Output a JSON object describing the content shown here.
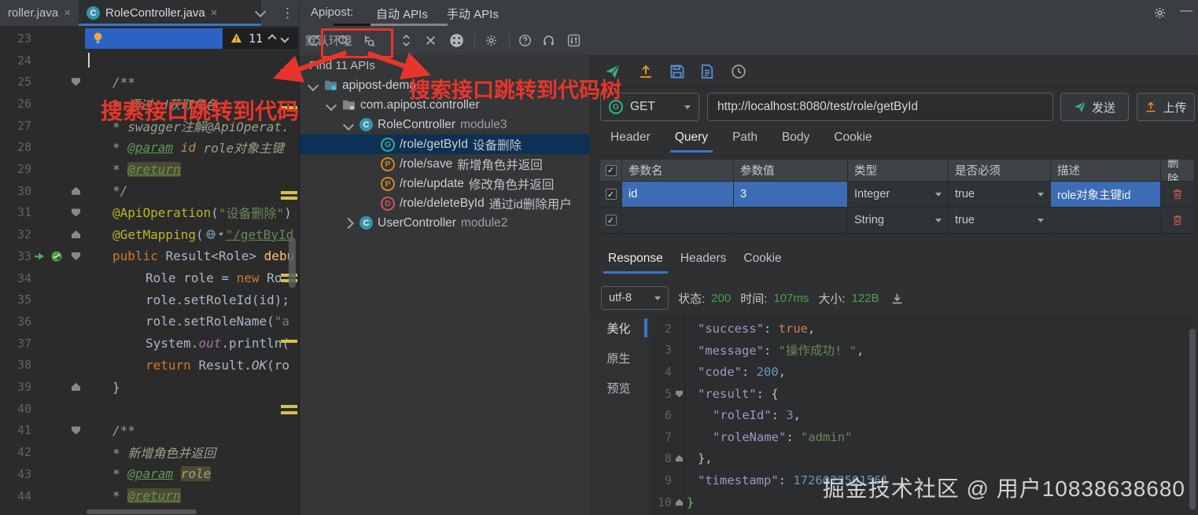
{
  "colors": {
    "accent": "#3876c8",
    "annotation_red": "#e8352b",
    "success_green": "#4d9e4d",
    "selection_blue": "#3c6cb4"
  },
  "window": {
    "tab_prev": "roller.java",
    "tab_active": "RoleController.java",
    "close_glyph": "×",
    "apipost_label": "Apipost:",
    "apipost_tabs": [
      "自动 APIs",
      "手动 APIs"
    ],
    "environment": "默认环境",
    "minimize_glyph": "—"
  },
  "editor": {
    "lightbulb": {
      "count": "11"
    },
    "lines": [
      {
        "n": 23,
        "type": "lightbulb"
      },
      {
        "n": 24,
        "type": "cursor"
      },
      {
        "n": 25,
        "indent": 1,
        "fold": "down",
        "segs": [
          {
            "t": "/**",
            "c": "doc"
          }
        ]
      },
      {
        "n": 26,
        "indent": 1,
        "segs": [
          {
            "t": "* 通过id获取角色",
            "c": "doc"
          }
        ]
      },
      {
        "n": 27,
        "indent": 1,
        "segs": [
          {
            "t": "* swagger注解@ApiOperat.",
            "c": "doc"
          }
        ]
      },
      {
        "n": 28,
        "indent": 1,
        "segs": [
          {
            "t": "* ",
            "c": "doc"
          },
          {
            "t": "@param",
            "c": "doctag"
          },
          {
            "t": " id",
            "c": "docparam"
          },
          {
            "t": " role对象主键",
            "c": "doc"
          }
        ]
      },
      {
        "n": 29,
        "indent": 1,
        "segs": [
          {
            "t": "* ",
            "c": "doc"
          },
          {
            "t": "@return",
            "c": "doctag hl"
          }
        ]
      },
      {
        "n": 30,
        "indent": 1,
        "fold": "up",
        "segs": [
          {
            "t": "*/",
            "c": "doc"
          }
        ]
      },
      {
        "n": 31,
        "indent": 1,
        "fold": "down",
        "segs": [
          {
            "t": "@ApiOperation",
            "c": "anno"
          },
          {
            "t": "(",
            "c": "plain"
          },
          {
            "t": "\"设备删除\"",
            "c": "str"
          },
          {
            "t": ")",
            "c": "plain"
          }
        ]
      },
      {
        "n": 32,
        "indent": 1,
        "fold": "up",
        "segs": [
          {
            "t": "@GetMapping",
            "c": "anno"
          },
          {
            "t": "(",
            "c": "plain"
          },
          {
            "t": "",
            "c": "icon-globe"
          },
          {
            "t": "\"/getById",
            "c": "str link"
          }
        ]
      },
      {
        "n": 33,
        "indent": 1,
        "fold": "down",
        "icons": [
          "run",
          "api"
        ],
        "segs": [
          {
            "t": "public ",
            "c": "kw"
          },
          {
            "t": "Result<Role> ",
            "c": "plain"
          },
          {
            "t": "debu",
            "c": "method"
          }
        ]
      },
      {
        "n": 34,
        "indent": 2,
        "segs": [
          {
            "t": "Role role = ",
            "c": "plain"
          },
          {
            "t": "new",
            "c": "kw"
          },
          {
            "t": " Ro",
            "c": "plain"
          }
        ]
      },
      {
        "n": 35,
        "indent": 2,
        "segs": [
          {
            "t": "role.setRoleId(id);",
            "c": "plain"
          }
        ]
      },
      {
        "n": 36,
        "indent": 2,
        "segs": [
          {
            "t": "role.setRoleName(",
            "c": "plain"
          },
          {
            "t": "\"a",
            "c": "str"
          }
        ]
      },
      {
        "n": 37,
        "indent": 2,
        "segs": [
          {
            "t": "System.",
            "c": "plain"
          },
          {
            "t": "out",
            "c": "field"
          },
          {
            "t": ".println(",
            "c": "plain"
          }
        ]
      },
      {
        "n": 38,
        "indent": 2,
        "segs": [
          {
            "t": "return ",
            "c": "kw"
          },
          {
            "t": "Result.",
            "c": "plain"
          },
          {
            "t": "OK",
            "c": "staticm"
          },
          {
            "t": "(ro",
            "c": "plain"
          }
        ]
      },
      {
        "n": 39,
        "indent": 1,
        "fold": "up",
        "segs": [
          {
            "t": "}",
            "c": "plain"
          }
        ]
      },
      {
        "n": 40,
        "indent": 1,
        "segs": []
      },
      {
        "n": 41,
        "indent": 1,
        "fold": "down",
        "segs": [
          {
            "t": "/**",
            "c": "doc"
          }
        ]
      },
      {
        "n": 42,
        "indent": 1,
        "segs": [
          {
            "t": "* 新增角色并返回",
            "c": "doc"
          }
        ]
      },
      {
        "n": 43,
        "indent": 1,
        "segs": [
          {
            "t": "* ",
            "c": "doc"
          },
          {
            "t": "@param",
            "c": "doctag"
          },
          {
            "t": " ",
            "c": "doc"
          },
          {
            "t": "role",
            "c": "doc hl"
          }
        ]
      },
      {
        "n": 44,
        "indent": 1,
        "segs": [
          {
            "t": "* ",
            "c": "doc"
          },
          {
            "t": "@return",
            "c": "doctag hl"
          }
        ]
      }
    ]
  },
  "tree": {
    "header": "Find 11 APIs",
    "items": [
      {
        "level": 0,
        "chevron": "down",
        "icon": "module-folder",
        "label": "apipost-demo"
      },
      {
        "level": 1,
        "chevron": "down",
        "icon": "package-folder",
        "label": "com.apipost.controller"
      },
      {
        "level": 2,
        "chevron": "down",
        "icon": "class",
        "letter": "C",
        "label": "RoleController",
        "suffix": "module3"
      },
      {
        "level": 3,
        "icon": "get",
        "letter": "G",
        "label": "/role/getById",
        "desc": "设备删除",
        "selected": true
      },
      {
        "level": 3,
        "icon": "post",
        "letter": "P",
        "label": "/role/save",
        "desc": "新增角色并返回"
      },
      {
        "level": 3,
        "icon": "post",
        "letter": "P",
        "label": "/role/update",
        "desc": "修改角色并返回"
      },
      {
        "level": 3,
        "icon": "delete",
        "letter": "D",
        "label": "/role/deleteById",
        "desc": "通过id删除用户"
      },
      {
        "level": 2,
        "chevron": "right",
        "icon": "class",
        "letter": "C",
        "label": "UserController",
        "suffix": "module2"
      }
    ]
  },
  "request": {
    "method": "GET",
    "method_initial": "G",
    "url": "http://localhost:8080/test/role/getById",
    "send_label": "发送",
    "upload_label": "上传",
    "tabs": [
      "Header",
      "Query",
      "Path",
      "Body",
      "Cookie"
    ],
    "active_tab": "Query",
    "params": {
      "headers": [
        "参数名",
        "参数值",
        "类型",
        "是否必须",
        "描述",
        "删除"
      ],
      "check_glyph": "✓",
      "rows": [
        {
          "checked": true,
          "name": "id",
          "value": "3",
          "type": "Integer",
          "required": "true",
          "desc": "role对象主键id",
          "selected": true
        },
        {
          "checked": true,
          "name": "",
          "value": "",
          "type": "String",
          "required": "true",
          "desc": ""
        }
      ]
    }
  },
  "response": {
    "tabs": [
      "Response",
      "Headers",
      "Cookie"
    ],
    "active_tab": "Response",
    "encoding": "utf-8",
    "status_label": "状态:",
    "status": "200",
    "time_label": "时间:",
    "time": "107ms",
    "size_label": "大小:",
    "size": "122B",
    "view_tabs": [
      "美化",
      "原生",
      "预览"
    ],
    "active_view": "美化",
    "json_lines": [
      {
        "n": 2,
        "indent": 1,
        "segs": [
          {
            "t": "\"success\"",
            "c": "jkey"
          },
          {
            "t": ": ",
            "c": "jplain"
          },
          {
            "t": "true",
            "c": "jbool"
          },
          {
            "t": ",",
            "c": "jplain"
          }
        ]
      },
      {
        "n": 3,
        "indent": 1,
        "segs": [
          {
            "t": "\"message\"",
            "c": "jkey"
          },
          {
            "t": ": ",
            "c": "jplain"
          },
          {
            "t": "\"操作成功! \"",
            "c": "jstr"
          },
          {
            "t": ",",
            "c": "jplain"
          }
        ]
      },
      {
        "n": 4,
        "indent": 1,
        "segs": [
          {
            "t": "\"code\"",
            "c": "jkey"
          },
          {
            "t": ": ",
            "c": "jplain"
          },
          {
            "t": "200",
            "c": "jnum"
          },
          {
            "t": ",",
            "c": "jplain"
          }
        ]
      },
      {
        "n": 5,
        "indent": 1,
        "fold": "down",
        "segs": [
          {
            "t": "\"result\"",
            "c": "jkey"
          },
          {
            "t": ": ",
            "c": "jplain"
          },
          {
            "t": "{",
            "c": "jplain"
          }
        ]
      },
      {
        "n": 6,
        "indent": 2,
        "segs": [
          {
            "t": "\"roleId\"",
            "c": "jkey"
          },
          {
            "t": ": ",
            "c": "jplain"
          },
          {
            "t": "3",
            "c": "jnum"
          },
          {
            "t": ",",
            "c": "jplain"
          }
        ]
      },
      {
        "n": 7,
        "indent": 2,
        "segs": [
          {
            "t": "\"roleName\"",
            "c": "jkey"
          },
          {
            "t": ": ",
            "c": "jplain"
          },
          {
            "t": "\"admin\"",
            "c": "jstr"
          }
        ]
      },
      {
        "n": 8,
        "indent": 1,
        "fold": "up",
        "segs": [
          {
            "t": "},",
            "c": "jplain"
          }
        ]
      },
      {
        "n": 9,
        "indent": 1,
        "segs": [
          {
            "t": "\"timestamp\"",
            "c": "jkey"
          },
          {
            "t": ": ",
            "c": "jplain"
          },
          {
            "t": "1726022501561",
            "c": "jnum"
          }
        ]
      },
      {
        "n": 10,
        "indent": 0,
        "fold": "up",
        "segs": [
          {
            "t": "}",
            "c": "jbrace"
          }
        ]
      }
    ]
  },
  "annotations": {
    "left_text": "搜索接口跳转到代码",
    "right_text": "搜索接口跳转到代码树"
  },
  "watermark": {
    "text": "掘金技术社区 @ 用户10838638680"
  }
}
